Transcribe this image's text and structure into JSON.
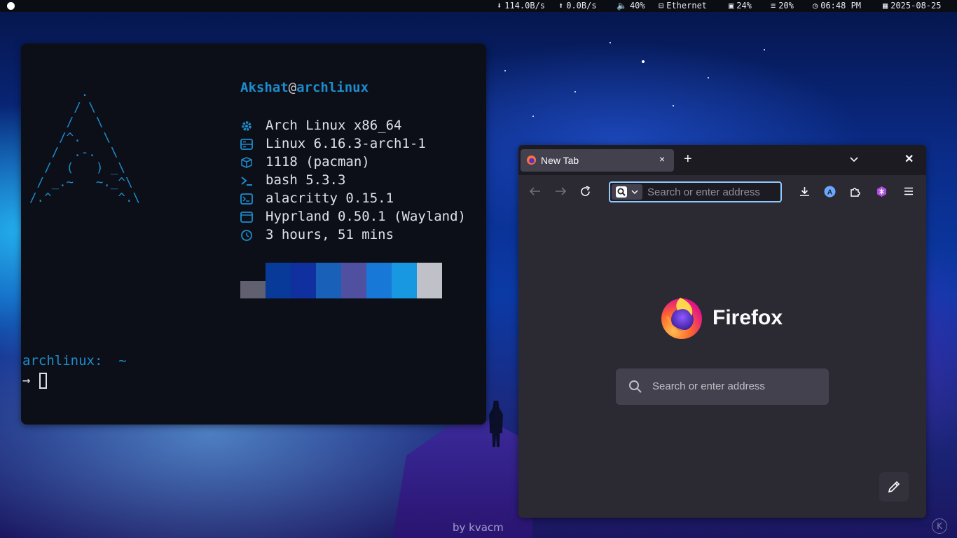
{
  "topbar": {
    "workspace_icon": "circle-dot",
    "net_down": "114.0B/s",
    "net_up": "0.0B/s",
    "volume": "40%",
    "network": "Ethernet",
    "cpu": "24%",
    "memory": "20%",
    "time": "06:48 PM",
    "date": "2025-08-25"
  },
  "terminal": {
    "user": "Akshat",
    "at": "@",
    "host": "archlinux",
    "info": [
      {
        "icon": "gear-icon",
        "text": "Arch Linux x86_64"
      },
      {
        "icon": "server-icon",
        "text": "Linux 6.16.3-arch1-1"
      },
      {
        "icon": "package-icon",
        "text": "1118 (pacman)"
      },
      {
        "icon": "shell-icon",
        "text": "bash 5.3.3"
      },
      {
        "icon": "terminal-icon",
        "text": "alacritty 0.15.1"
      },
      {
        "icon": "window-icon",
        "text": "Hyprland 0.50.1 (Wayland)"
      },
      {
        "icon": "clock-icon",
        "text": "3 hours, 51 mins"
      }
    ],
    "palette": [
      "#0d0f18",
      "#083a9a",
      "#1030a0",
      "#1860b8",
      "#5050a0",
      "#1878d8",
      "#1898e0",
      "#c0c0c8"
    ],
    "palette_low": "#606070",
    "prompt_host": "archlinux:",
    "prompt_dir": "~",
    "prompt_arrow": "→"
  },
  "firefox": {
    "tab_title": "New Tab",
    "tab_close": "×",
    "new_tab": "+",
    "window_close": "✕",
    "url_placeholder": "Search or enter address",
    "brand": "Firefox",
    "search_placeholder": "Search or enter address"
  },
  "wallpaper_credit": "by kvacm",
  "corner_badge": "K"
}
